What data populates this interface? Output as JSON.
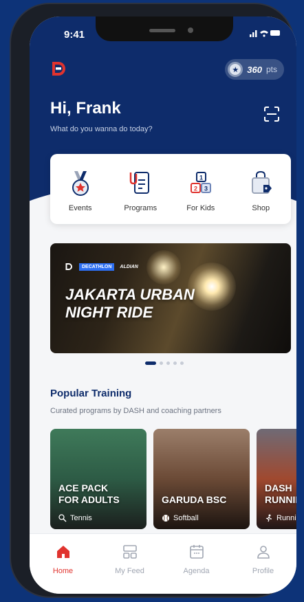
{
  "status": {
    "time": "9:41",
    "icons": "..ıl ≈ ▬"
  },
  "header": {
    "points_value": "360",
    "points_unit": "pts",
    "greeting": "Hi, Frank",
    "subtitle": "What do you wanna do today?"
  },
  "menu": [
    {
      "label": "Events",
      "icon": "medal-icon"
    },
    {
      "label": "Programs",
      "icon": "clipboard-icon"
    },
    {
      "label": "For Kids",
      "icon": "blocks-icon"
    },
    {
      "label": "Shop",
      "icon": "shopping-bag-icon"
    }
  ],
  "banner": {
    "title_line1": "JAKARTA URBAN",
    "title_line2": "NIGHT RIDE",
    "sponsor1": "DECATHLON",
    "sponsor2": "ALDIAN"
  },
  "carousel": {
    "count": 5,
    "active": 0
  },
  "popular": {
    "title": "Popular Training",
    "subtitle": "Curated programs by DASH and coaching partners",
    "cards": [
      {
        "line1": "ACE PACK",
        "line2": "FOR ADULTS",
        "sport": "Tennis"
      },
      {
        "line1": "GARUDA BSC",
        "line2": "",
        "sport": "Softball"
      },
      {
        "line1": "DASH",
        "line2": "RUNNING",
        "sport": "Running"
      }
    ]
  },
  "tabs": [
    {
      "label": "Home",
      "active": true
    },
    {
      "label": "My Feed",
      "active": false
    },
    {
      "label": "Agenda",
      "active": false
    },
    {
      "label": "Profile",
      "active": false
    }
  ],
  "colors": {
    "brand": "#0e2c6b",
    "accent": "#e0332e"
  }
}
